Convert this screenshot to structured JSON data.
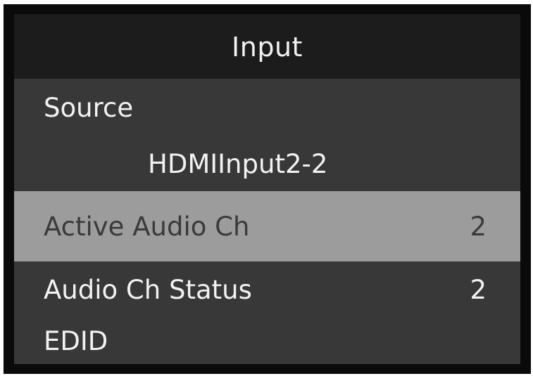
{
  "menu": {
    "title": "Input",
    "items": [
      {
        "label": "Source",
        "value": ""
      },
      {
        "label": "Active Audio Ch",
        "value": "2",
        "selected": true
      },
      {
        "label": "Audio Ch Status",
        "value": "2"
      },
      {
        "label": "EDID",
        "value": ""
      }
    ],
    "source_value": "HDMIInput2-2"
  },
  "colors": {
    "frame": "#0a0a0a",
    "title_bar": "#1c1c1c",
    "menu_bg": "#383838",
    "highlight": "#9c9c9c",
    "text": "#f2f2f2",
    "highlight_text": "#3a3a3a"
  }
}
